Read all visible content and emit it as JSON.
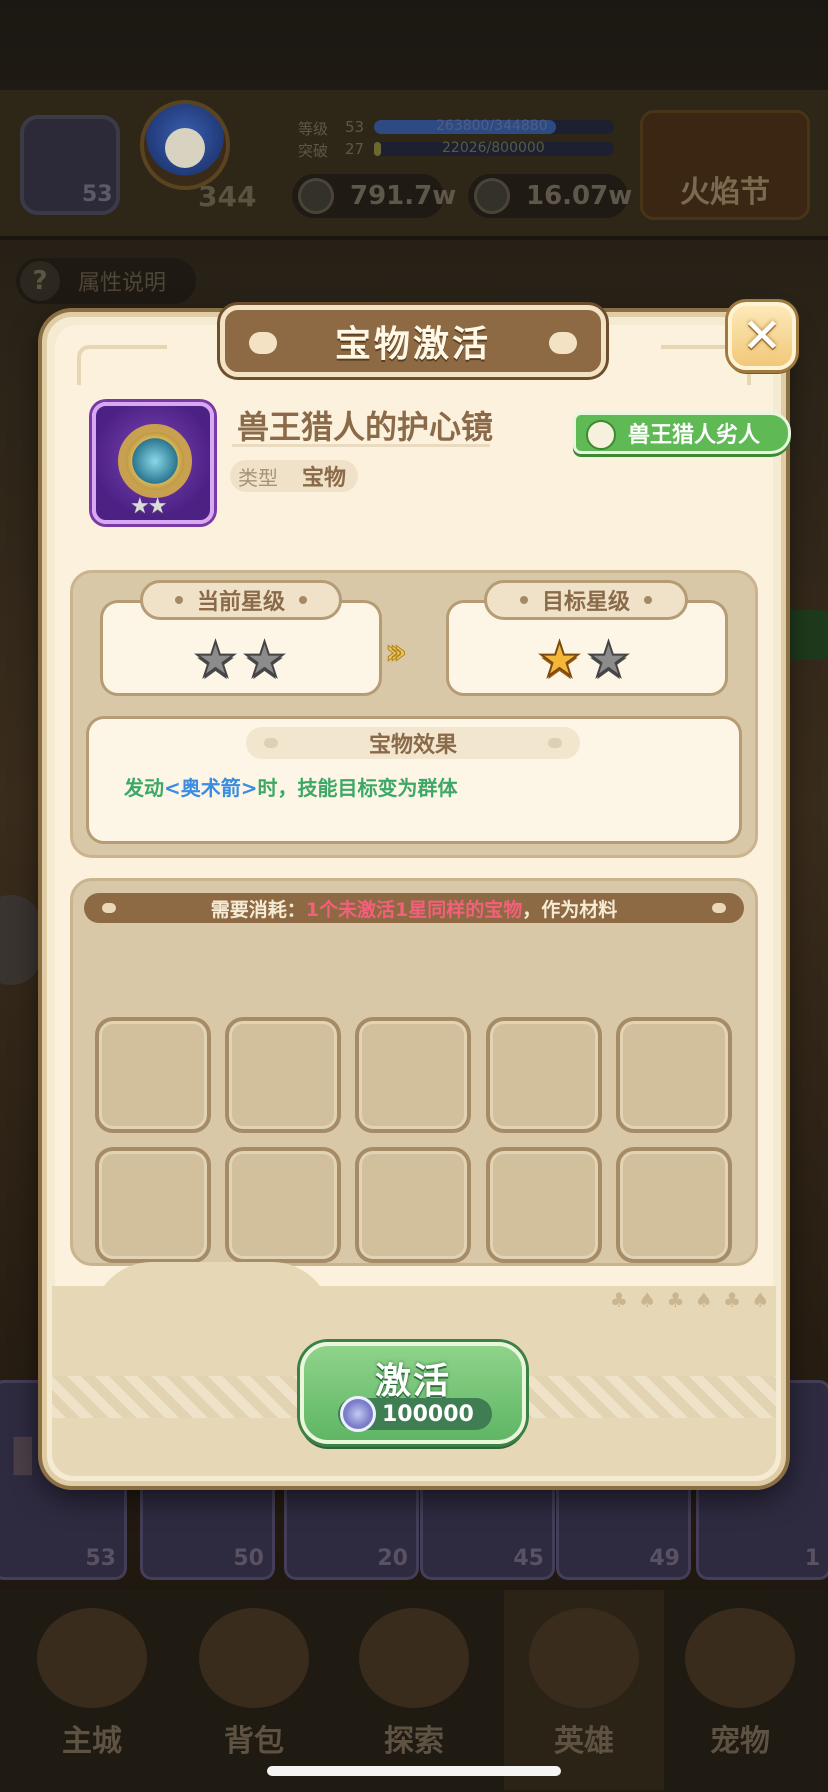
{
  "background": {
    "level_label": "等级",
    "level_value": "53",
    "level_xp": "263800/344880",
    "break_label": "突破",
    "break_value": "27",
    "break_xp": "22026/800000",
    "power": "344",
    "hero_level": "53",
    "gold": "791.7w",
    "gems": "16.07w",
    "event": "火焰节",
    "help": "属性说明",
    "card_levels": [
      "53",
      "50",
      "20",
      "45",
      "49",
      "1"
    ],
    "nav": [
      "主城",
      "背包",
      "探索",
      "英雄",
      "宠物"
    ]
  },
  "modal": {
    "title": "宝物激活",
    "close_glyph": "✕",
    "item": {
      "name": "兽王猎人的护心镜",
      "type_label": "类型",
      "type_value": "宝物",
      "stars": "★★",
      "set_tag": "兽王猎人劣人"
    },
    "current_star_label": "当前星级",
    "target_star_label": "目标星级",
    "current_stars": [
      {
        "filled": false
      },
      {
        "filled": false
      }
    ],
    "target_stars": [
      {
        "filled": true
      },
      {
        "filled": false
      }
    ],
    "arrows": "›››",
    "effect": {
      "header": "宝物效果",
      "prefix": "发动",
      "skill": "<奥术箭>",
      "suffix": "时，技能目标变为群体"
    },
    "materials": {
      "prefix": "需要消耗：",
      "highlight": "1个未激活1星同样的宝物",
      "suffix": "，作为材料",
      "slots": 10
    },
    "activate_button": {
      "label": "激活",
      "cost": "100000"
    }
  },
  "colors": {
    "panel": "#fbf1dd",
    "accent_brown": "#8d6a44",
    "button_green": "#5fb665",
    "highlight_red": "#f2607a",
    "effect_green": "#3da866",
    "skill_blue": "#3a8de0"
  }
}
